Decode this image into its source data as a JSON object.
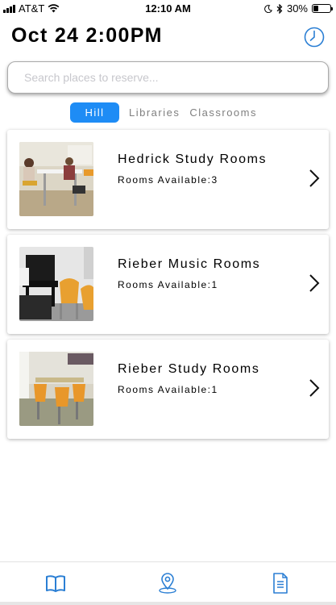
{
  "status_bar": {
    "carrier": "AT&T",
    "time": "12:10 AM",
    "battery": "30%",
    "battery_level": 0.3,
    "icons": [
      "signal-icon",
      "wifi-icon",
      "moon-icon",
      "bluetooth-icon",
      "battery-icon"
    ]
  },
  "header": {
    "date_time": "Oct 24 2:00PM",
    "clock_icon": "clock-icon"
  },
  "search": {
    "placeholder": "Search places to reserve...",
    "value": ""
  },
  "segments": [
    {
      "label": "Hill",
      "selected": true
    },
    {
      "label": "Libraries",
      "selected": false
    },
    {
      "label": "Classrooms",
      "selected": false
    }
  ],
  "places": [
    {
      "name": "Hedrick Study Rooms",
      "availability": "Rooms Available:3"
    },
    {
      "name": "Rieber Music Rooms",
      "availability": "Rooms Available:1"
    },
    {
      "name": "Rieber Study Rooms",
      "availability": "Rooms Available:1"
    }
  ],
  "tab_bar": {
    "tabs": [
      "book-icon",
      "map-pin-icon",
      "document-icon"
    ]
  },
  "colors": {
    "accent": "#1e8cf5",
    "segment_inactive": "#7f7f7f",
    "tab_icon": "#2b7fd4"
  }
}
